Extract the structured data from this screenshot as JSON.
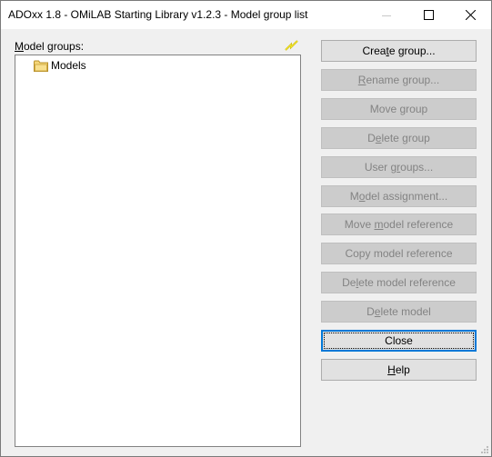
{
  "window": {
    "title": "ADOxx 1.8 - OMiLAB Starting Library v1.2.3 - Model group list",
    "controls": [
      "minimize-icon",
      "maximize-icon",
      "close-icon"
    ]
  },
  "tree": {
    "label_prefix": "M",
    "label_rest": "odel groups:",
    "refresh_icon": "lightning-icon",
    "items": [
      {
        "label": "Models",
        "icon": "folder-icon"
      }
    ]
  },
  "buttons": [
    {
      "pre": "Crea",
      "key": "t",
      "post": "e group...",
      "enabled": true
    },
    {
      "pre": "",
      "key": "R",
      "post": "ename group...",
      "enabled": false
    },
    {
      "pre": "Move ",
      "key": "g",
      "post": "roup",
      "enabled": false
    },
    {
      "pre": "D",
      "key": "e",
      "post": "lete group",
      "enabled": false
    },
    {
      "pre": "User g",
      "key": "r",
      "post": "oups...",
      "enabled": false
    },
    {
      "pre": "M",
      "key": "o",
      "post": "del assignment...",
      "enabled": false
    },
    {
      "pre": "Move ",
      "key": "m",
      "post": "odel reference",
      "enabled": false
    },
    {
      "pre": "Copy model reference",
      "key": "",
      "post": "",
      "enabled": false
    },
    {
      "pre": "De",
      "key": "l",
      "post": "ete model reference",
      "enabled": false
    },
    {
      "pre": "D",
      "key": "e",
      "post": "lete model",
      "enabled": false
    },
    {
      "pre": "Close",
      "key": "",
      "post": "",
      "enabled": true,
      "focused": true
    },
    {
      "pre": "",
      "key": "H",
      "post": "elp",
      "enabled": true
    }
  ]
}
